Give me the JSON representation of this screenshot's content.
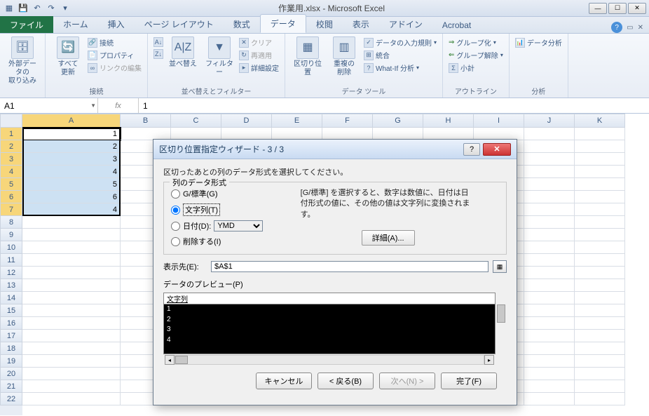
{
  "titlebar": {
    "title": "作業用.xlsx - Microsoft Excel"
  },
  "tabs": {
    "file": "ファイル",
    "items": [
      "ホーム",
      "挿入",
      "ページ レイアウト",
      "数式",
      "データ",
      "校閲",
      "表示",
      "アドイン",
      "Acrobat"
    ],
    "active_index": 4
  },
  "ribbon": {
    "ext_data": {
      "big": "外部データの\n取り込み"
    },
    "connections": {
      "refresh": "すべて\n更新",
      "conn": "接続",
      "prop": "プロパティ",
      "edit": "リンクの編集",
      "label": "接続"
    },
    "sort": {
      "az": "A→Z",
      "za": "Z→A",
      "sort": "並べ替え",
      "filter": "フィルター",
      "clear": "クリア",
      "reapply": "再適用",
      "advanced": "詳細設定",
      "label": "並べ替えとフィルター"
    },
    "datatools": {
      "text_to_col": "区切り位置",
      "remove_dup": "重複の\n削除",
      "validation": "データの入力規則",
      "consolidate": "統合",
      "whatif": "What-If 分析",
      "label": "データ ツール"
    },
    "outline": {
      "group": "グループ化",
      "ungroup": "グループ解除",
      "subtotal": "小計",
      "label": "アウトライン"
    },
    "analysis": {
      "data_analysis": "データ分析",
      "label": "分析"
    }
  },
  "namebox": "A1",
  "formula": "1",
  "columns": [
    "A",
    "B",
    "C",
    "D",
    "E",
    "F",
    "G",
    "H",
    "I",
    "J",
    "K"
  ],
  "rows": [
    1,
    2,
    3,
    4,
    5,
    6,
    7,
    8,
    9,
    10,
    11,
    12,
    13,
    14,
    15,
    16,
    17,
    18,
    19,
    20,
    21,
    22
  ],
  "cell_data": [
    "1",
    "2",
    "3",
    "4",
    "5",
    "6",
    "4"
  ],
  "dialog": {
    "title": "区切り位置指定ウィザード - 3 / 3",
    "instruction": "区切ったあとの列のデータ形式を選択してください。",
    "fieldset_legend": "列のデータ形式",
    "radios": {
      "general": "G/標準(G)",
      "text": "文字列(T)",
      "date": "日付(D):",
      "skip": "削除する(I)"
    },
    "date_format": "YMD",
    "description": "[G/標準] を選択すると、数字は数値に、日付は日付形式の値に、その他の値は文字列に変換されます。",
    "detail_btn": "詳細(A)...",
    "dest_label": "表示先(E):",
    "dest_value": "$A$1",
    "preview_label": "データのプレビュー(P)",
    "preview_header": "文字列",
    "preview_rows": [
      "1",
      "2",
      "3",
      "4"
    ],
    "buttons": {
      "cancel": "キャンセル",
      "back": "< 戻る(B)",
      "next": "次へ(N) >",
      "finish": "完了(F)"
    }
  },
  "chart_data": null
}
